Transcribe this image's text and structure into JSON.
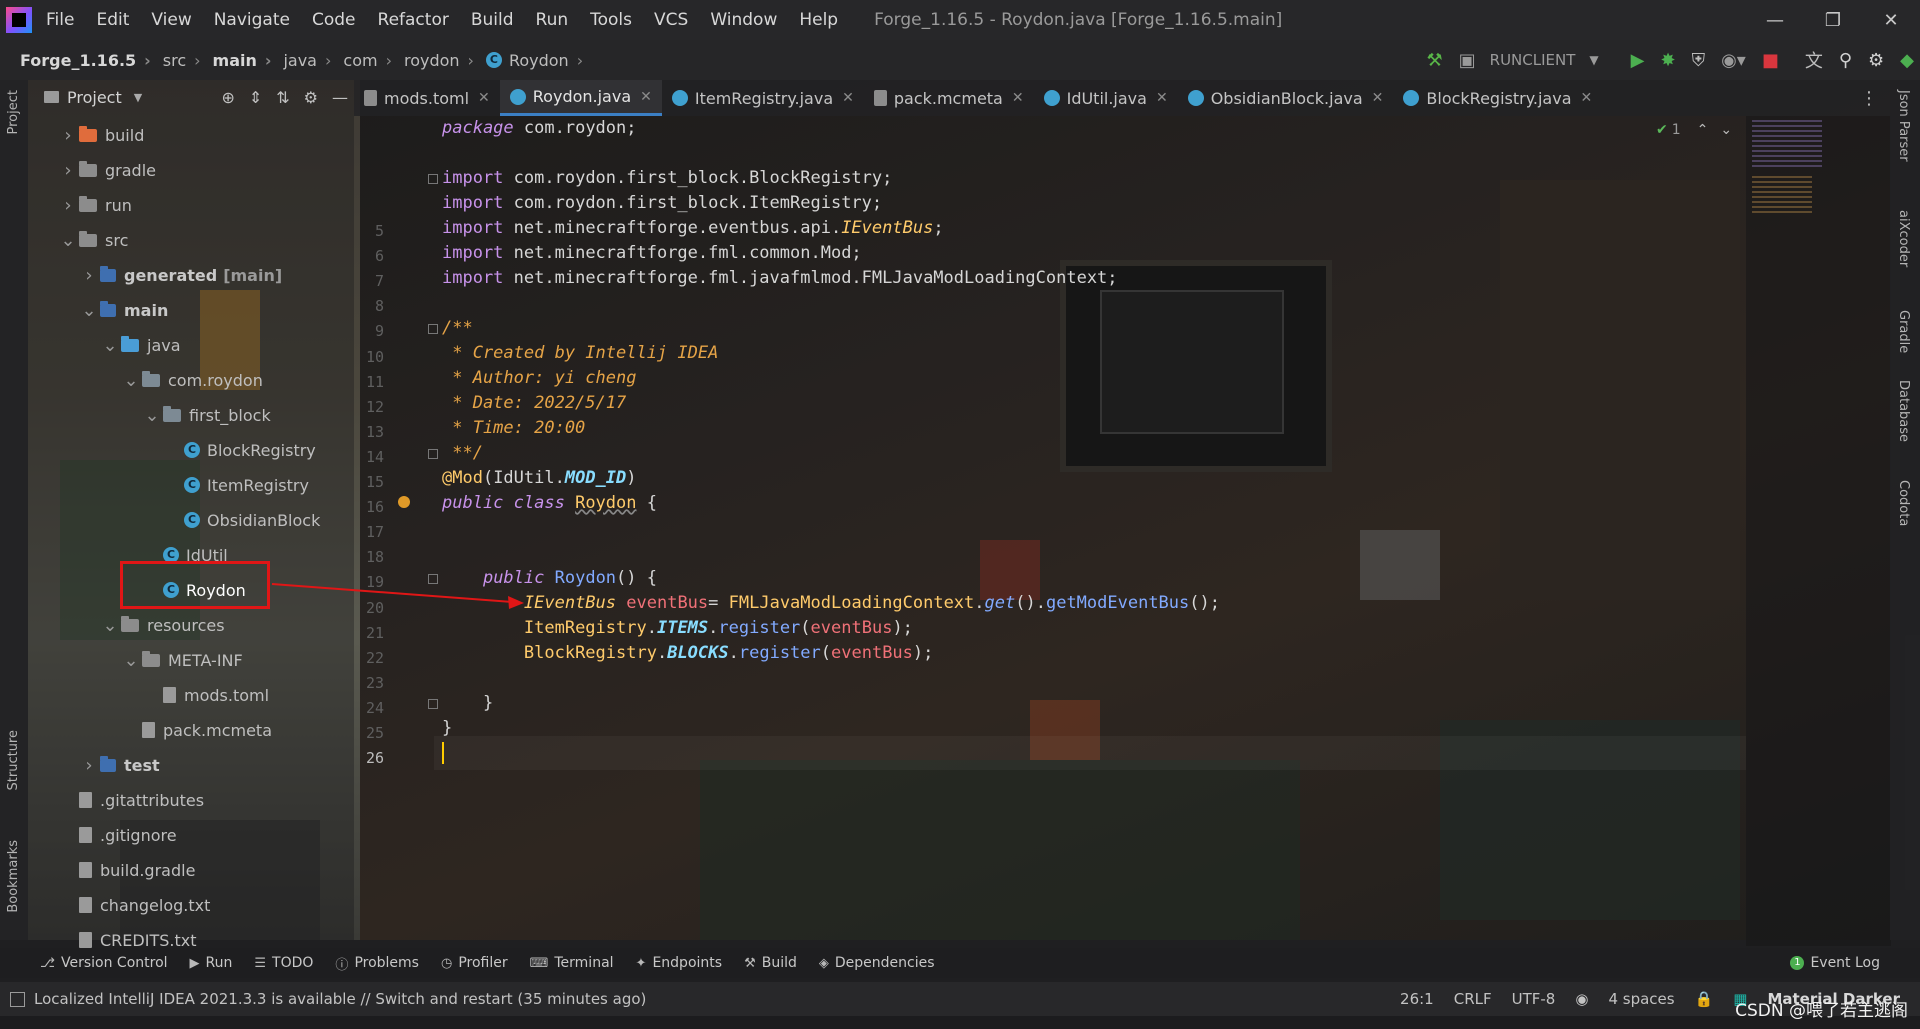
{
  "menubar": {
    "items": [
      {
        "label": "File"
      },
      {
        "label": "Edit"
      },
      {
        "label": "View"
      },
      {
        "label": "Navigate"
      },
      {
        "label": "Code"
      },
      {
        "label": "Refactor"
      },
      {
        "label": "Build"
      },
      {
        "label": "Run"
      },
      {
        "label": "Tools"
      },
      {
        "label": "VCS"
      },
      {
        "label": "Window"
      },
      {
        "label": "Help"
      }
    ],
    "window_title": "Forge_1.16.5 - Roydon.java [Forge_1.16.5.main]"
  },
  "navbar": {
    "crumbs": [
      "Forge_1.16.5",
      "src",
      "main",
      "java",
      "com",
      "roydon",
      "Roydon"
    ],
    "run_config": "RUNCLIENT"
  },
  "project": {
    "title": "Project",
    "tree": [
      {
        "label": "build",
        "type": "folder",
        "color": "#e06c3c"
      },
      {
        "label": "gradle",
        "type": "folder",
        "color": "#8c8c8c"
      },
      {
        "label": "run",
        "type": "folder",
        "color": "#8c8c8c"
      },
      {
        "label": "src",
        "type": "folder",
        "color": "#8c8c8c"
      },
      {
        "label": "generated",
        "suffix": "[main]",
        "type": "module"
      },
      {
        "label": "main",
        "type": "module"
      },
      {
        "label": "java",
        "type": "folder",
        "color": "#4a9dd6"
      },
      {
        "label": "com.roydon",
        "type": "package"
      },
      {
        "label": "first_block",
        "type": "package"
      },
      {
        "label": "BlockRegistry",
        "type": "class"
      },
      {
        "label": "ItemRegistry",
        "type": "class"
      },
      {
        "label": "ObsidianBlock",
        "type": "class"
      },
      {
        "label": "IdUtil",
        "type": "class"
      },
      {
        "label": "Roydon",
        "type": "class"
      },
      {
        "label": "resources",
        "type": "folder",
        "color": "#8c8c8c"
      },
      {
        "label": "META-INF",
        "type": "folder",
        "color": "#8c8c8c"
      },
      {
        "label": "mods.toml",
        "type": "file"
      },
      {
        "label": "pack.mcmeta",
        "type": "file"
      },
      {
        "label": "test",
        "type": "module"
      },
      {
        "label": ".gitattributes",
        "type": "file"
      },
      {
        "label": ".gitignore",
        "type": "file"
      },
      {
        "label": "build.gradle",
        "type": "file"
      },
      {
        "label": "changelog.txt",
        "type": "file"
      },
      {
        "label": "CREDITS.txt",
        "type": "file"
      }
    ]
  },
  "tabs": [
    {
      "label": "mods.toml",
      "icon": "doc"
    },
    {
      "label": "Roydon.java",
      "icon": "class",
      "active": true
    },
    {
      "label": "ItemRegistry.java",
      "icon": "class"
    },
    {
      "label": "pack.mcmeta",
      "icon": "doc"
    },
    {
      "label": "IdUtil.java",
      "icon": "class"
    },
    {
      "label": "ObsidianBlock.java",
      "icon": "class"
    },
    {
      "label": "BlockRegistry.java",
      "icon": "class"
    }
  ],
  "editor": {
    "line_numbers": [
      "5",
      "6",
      "7",
      "8",
      "9",
      "10",
      "11",
      "12",
      "13",
      "14",
      "15",
      "16",
      "17",
      "18",
      "19",
      "20",
      "21",
      "22",
      "23",
      "24",
      "25",
      "26"
    ],
    "inspection_count": "1"
  },
  "left_strip": {
    "project": "Project",
    "structure": "Structure",
    "bookmarks": "Bookmarks"
  },
  "right_strip": [
    "Json Parser",
    "aiXcoder",
    "Gradle",
    "Database",
    "Codota"
  ],
  "bottom_tools": [
    {
      "label": "Version Control",
      "icon": "branch-icon"
    },
    {
      "label": "Run",
      "icon": "play-icon"
    },
    {
      "label": "TODO",
      "icon": "list-icon"
    },
    {
      "label": "Problems",
      "icon": "info-icon"
    },
    {
      "label": "Profiler",
      "icon": "gauge-icon"
    },
    {
      "label": "Terminal",
      "icon": "terminal-icon"
    },
    {
      "label": "Endpoints",
      "icon": "endpoints-icon"
    },
    {
      "label": "Build",
      "icon": "hammer-icon"
    },
    {
      "label": "Dependencies",
      "icon": "layers-icon"
    }
  ],
  "event_log": "Event Log",
  "status": {
    "message": "Localized IntelliJ IDEA 2021.3.3 is available // Switch and restart (35 minutes ago)",
    "position": "26:1",
    "line_sep": "CRLF",
    "encoding": "UTF-8",
    "indent": "4 spaces",
    "theme": "Material Darker"
  },
  "watermark": "CSDN @喂了若主逃阁",
  "colors": {
    "accent": "#3b7fc4",
    "highlight_box": "#e01616",
    "caret": "#ffcc00"
  }
}
